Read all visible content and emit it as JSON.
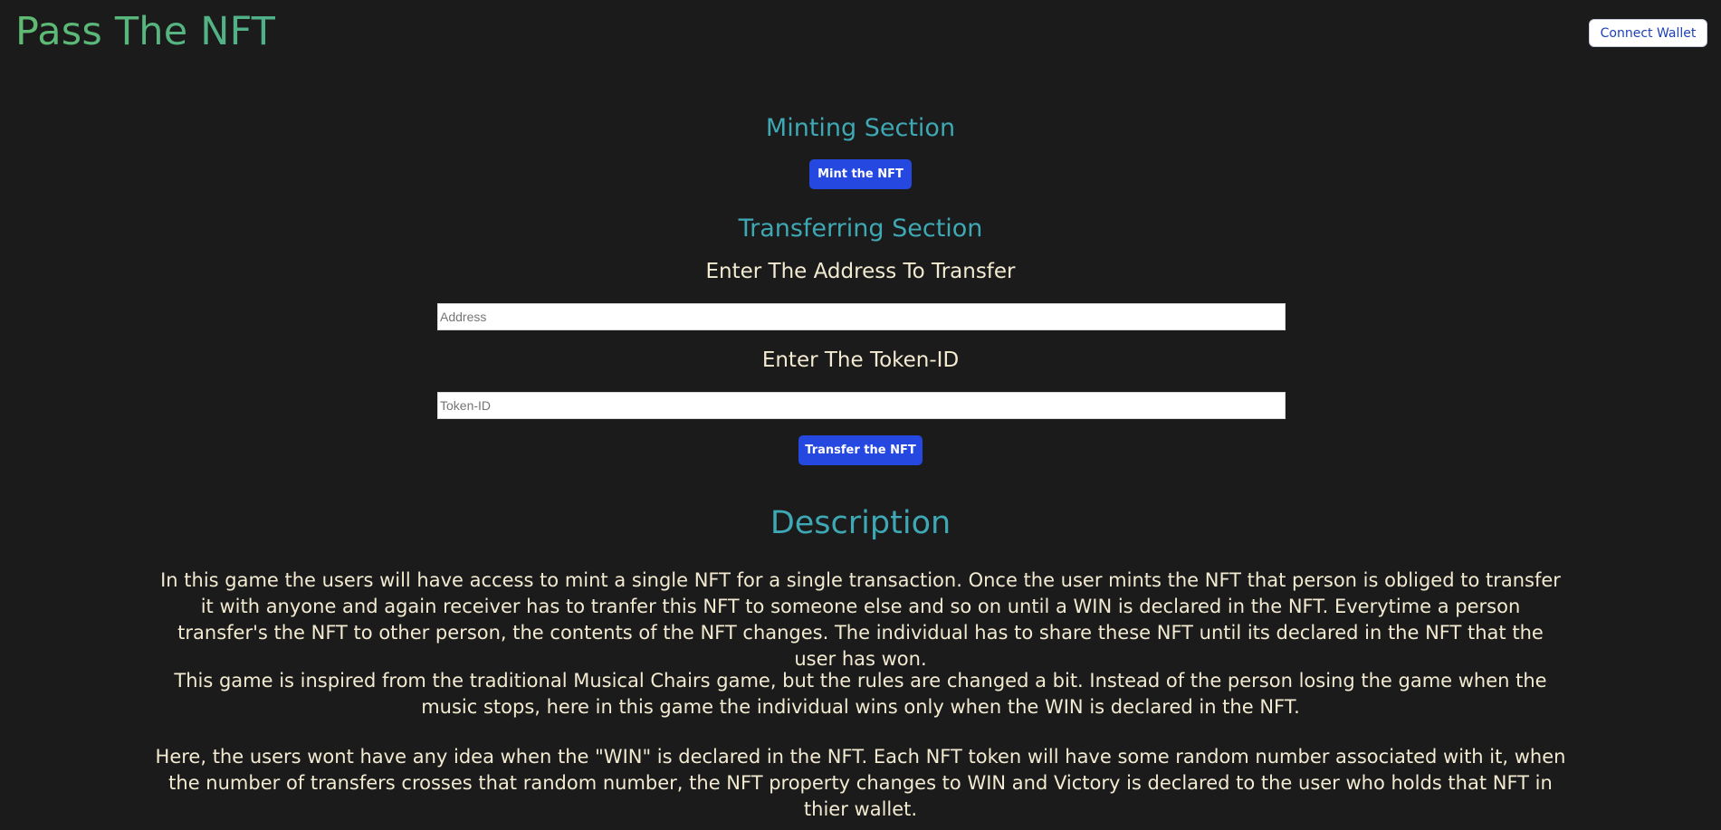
{
  "header": {
    "title": "Pass The NFT",
    "connect_label": "Connect Wallet"
  },
  "minting": {
    "title": "Minting Section",
    "button_label": "Mint the NFT"
  },
  "transferring": {
    "title": "Transferring Section",
    "address_label": "Enter The Address To Transfer",
    "address_placeholder": "Address",
    "token_label": "Enter The Token-ID",
    "token_placeholder": "Token-ID",
    "button_label": "Transfer the NFT"
  },
  "description": {
    "title": "Description",
    "paragraphs": [
      "In this game the users will have access to mint a single NFT for a single transaction. Once the user mints the NFT that person is obliged to transfer it with anyone and again receiver has to tranfer this NFT to someone else and so on until a WIN is declared in the NFT. Everytime a person transfer's the NFT to other person, the contents of the NFT changes. The individual has to share these NFT until its declared in the NFT that the user has won.",
      "This game is inspired from the traditional Musical Chairs game, but the rules are changed a bit. Instead of the person losing the game when the music stops, here in this game the individual wins only when the WIN is declared in the NFT.",
      "Here, the users wont have any idea when the \"WIN\" is declared in the NFT. Each NFT token will have some random number associated with it, when the number of transfers crosses that random number, the NFT property changes to WIN and Victory is declared to the user who holds that NFT in thier wallet."
    ]
  },
  "colors": {
    "background": "#1b1b1b",
    "brand_green": "#5fbb72",
    "section_teal": "#3ea8b4",
    "body_text": "#f2ead1",
    "button_blue": "#2548e0",
    "connect_text": "#1d3fb8"
  }
}
